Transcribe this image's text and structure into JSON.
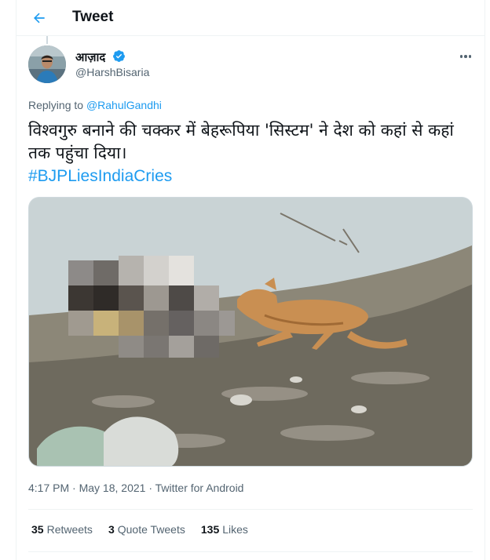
{
  "header": {
    "title": "Tweet",
    "back_icon": "arrow-left-icon",
    "accent": "#1d9bf0"
  },
  "tweet": {
    "author_name": "आज़ाद",
    "author_handle": "@HarshBisaria",
    "verified_icon": "verified-badge-icon",
    "replying_prefix": "Replying to ",
    "replying_handle": "@RahulGandhi",
    "text": "विश्वगुरु बनाने की चक्कर में बेहरूपिया 'सिस्टम' ने देश को कहां से कहां तक पहुंचा दिया।",
    "hashtag": "#BJPLiesIndiaCries",
    "time": "4:17 PM",
    "date": "May 18, 2021",
    "source": "Twitter for Android",
    "separator": " · "
  },
  "stats": {
    "retweets_count": "35",
    "retweets_label": "Retweets",
    "quotes_count": "3",
    "quotes_label": "Quote Tweets",
    "likes_count": "135",
    "likes_label": "Likes"
  }
}
